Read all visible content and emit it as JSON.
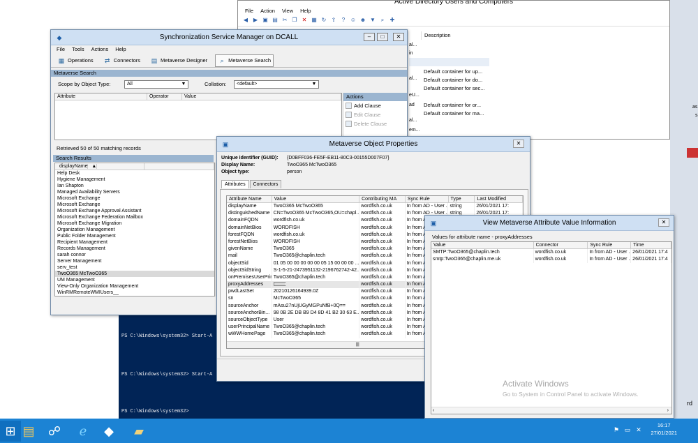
{
  "aduc": {
    "title": "Active Directory Users and Computers",
    "menu": [
      "File",
      "Action",
      "View",
      "Help"
    ],
    "column_header": "Description",
    "left_fragments": [
      "al...",
      "in",
      "al...",
      "eU...",
      "ad",
      "al...",
      "em..."
    ],
    "descriptions": [
      "Default container for up...",
      "Default container for do...",
      "Default container for sec...",
      "Default container for or...",
      "Default container for ma..."
    ]
  },
  "ssm": {
    "title": "Synchronization Service Manager on DCALL",
    "menu": [
      "File",
      "Tools",
      "Actions",
      "Help"
    ],
    "tabs": [
      "Operations",
      "Connectors",
      "Metaverse Designer",
      "Metaverse Search"
    ],
    "section_title": "Metaverse Search",
    "scope_label": "Scope by Object Type:",
    "scope_value": "All",
    "collation_label": "Collation:",
    "collation_value": "<default>",
    "grid_headers": [
      "Attribute",
      "Operator",
      "Value"
    ],
    "actions_title": "Actions",
    "actions": [
      {
        "label": "Add Clause",
        "enabled": true
      },
      {
        "label": "Edit Clause",
        "enabled": false
      },
      {
        "label": "Delete Clause",
        "enabled": false
      }
    ],
    "records_status": "Retrieved 50 of 50 matching records",
    "results_title": "Search Results",
    "results_header": "displayName",
    "results": [
      "Help Desk",
      "Hygiene Management",
      "Ian Shapton",
      "Managed Availability Servers",
      "Microsoft Exchange",
      "Microsoft Exchange",
      "Microsoft Exchange Approval Assistant",
      "Microsoft Exchange Federation Mailbox",
      "Microsoft Exchange Migration",
      "Organization Management",
      "Public Folder Management",
      "Recipient Management",
      "Records Management",
      "sarah connor",
      "Server Management",
      "serv_test",
      "TwoO365 McTwoO365",
      "UM Management",
      "View-Only Organization Management",
      "WinRMRemoteWMIUsers__"
    ],
    "selected_result": 16
  },
  "powershell": {
    "lines": [
      "PS C:\\Windows\\system32> Start-A",
      "PS C:\\Windows\\system32> Start-A",
      "PS C:\\Windows\\system32>"
    ]
  },
  "mop": {
    "title": "Metaverse Object Properties",
    "guid_label": "Unique identifier (GUID):",
    "guid_value": "{D0BFF036-FE5F-EB11-80C3-00155D007F07}",
    "display_label": "Display Name:",
    "display_value": "TwoO365 McTwoO365",
    "type_label": "Object type:",
    "type_value": "person",
    "tabs": [
      "Attributes",
      "Connectors"
    ],
    "headers": [
      "Attribute Name",
      "Value",
      "Contributing MA",
      "Sync Rule",
      "Type",
      "Last Modified"
    ],
    "rows": [
      [
        "displayName",
        "TwoO365 McTwoO365",
        "wordfish.co.uk",
        "In from AD - User ...",
        "string",
        "26/01/2021 17:"
      ],
      [
        "distinguishedName",
        "CN=TwoO365 McTwoO365,OU=chapl...",
        "wordfish.co.uk",
        "In from AD - User ...",
        "string",
        "26/01/2021 17:"
      ],
      [
        "domainFQDN",
        "wordfish.co.uk",
        "wordfish.co.uk",
        "In from A",
        "",
        ""
      ],
      [
        "domainNetBios",
        "WORDFISH",
        "wordfish.co.uk",
        "In from A",
        "",
        ""
      ],
      [
        "forestFQDN",
        "wordfish.co.uk",
        "wordfish.co.uk",
        "In from A",
        "",
        ""
      ],
      [
        "forestNetBios",
        "WORDFISH",
        "wordfish.co.uk",
        "In from A",
        "",
        ""
      ],
      [
        "givenName",
        "TwoO365",
        "wordfish.co.uk",
        "In from A",
        "",
        ""
      ],
      [
        "mail",
        "TwoO365@chaplin.tech",
        "wordfish.co.uk",
        "In from A",
        "",
        ""
      ],
      [
        "objectSid",
        "01 05 00 00 00 00 00 05 15 00 00 00 ...",
        "wordfish.co.uk",
        "In from A",
        "",
        ""
      ],
      [
        "objectSidString",
        "S-1-5-21-2473951132-2196762742-42...",
        "wordfish.co.uk",
        "In from A",
        "",
        ""
      ],
      [
        "onPremisesUserPrinc...",
        "TwoO365@chaplin.tech",
        "wordfish.co.uk",
        "In from A",
        "",
        ""
      ],
      [
        "proxyAddresses",
        "",
        "wordfish.co.uk",
        "In from A",
        "",
        ""
      ],
      [
        "pwdLastSet",
        "20210126164939.0Z",
        "wordfish.co.uk",
        "In from A",
        "",
        ""
      ],
      [
        "sn",
        "McTwoO365",
        "wordfish.co.uk",
        "In from A",
        "",
        ""
      ],
      [
        "sourceAnchor",
        "mAsu27nUjUGyMGPuNfB+0Q==",
        "wordfish.co.uk",
        "In from A",
        "",
        ""
      ],
      [
        "sourceAnchorBin...",
        "98 0B 2E DB B9 D4 8D 41 B2 30 63 E...",
        "wordfish.co.uk",
        "In from A",
        "",
        ""
      ],
      [
        "sourceObjectType",
        "User",
        "wordfish.co.uk",
        "In from A",
        "",
        ""
      ],
      [
        "userPrincipalName",
        "TwoO365@chaplin.tech",
        "wordfish.co.uk",
        "In from A",
        "",
        ""
      ],
      [
        "wWWHomePage",
        "TwoO365@chaplin.tech",
        "wordfish.co.uk",
        "In from A",
        "",
        ""
      ]
    ],
    "selected_row": 11
  },
  "vmav": {
    "title": "View Metaverse Attribute Value Information",
    "caption": "Values for attribute name - proxyAddresses",
    "headers": [
      "Value",
      "Connector",
      "Sync Rule",
      "Time"
    ],
    "rows": [
      [
        "SMTP:TwoO365@chaplin.tech",
        "wordfish.co.uk",
        "In from AD - User ...",
        "26/01/2021 17:4"
      ],
      [
        "smtp:TwoO365@chaplin.me.uk",
        "wordfish.co.uk",
        "In from AD - User ...",
        "26/01/2021 17:4"
      ]
    ]
  },
  "watermark": {
    "title": "Activate Windows",
    "subtitle": "Go to System in Control Panel to activate Windows."
  },
  "taskbar": {
    "time": "16:17",
    "date": "27/01/2021",
    "apps": [
      "windows-logo-icon",
      "file-explorer-icon",
      "network-icon",
      "internet-explorer-icon",
      "sync-manager-icon",
      "folder-icon"
    ]
  },
  "edge_fragments": [
    "as",
    "s",
    "rd"
  ]
}
